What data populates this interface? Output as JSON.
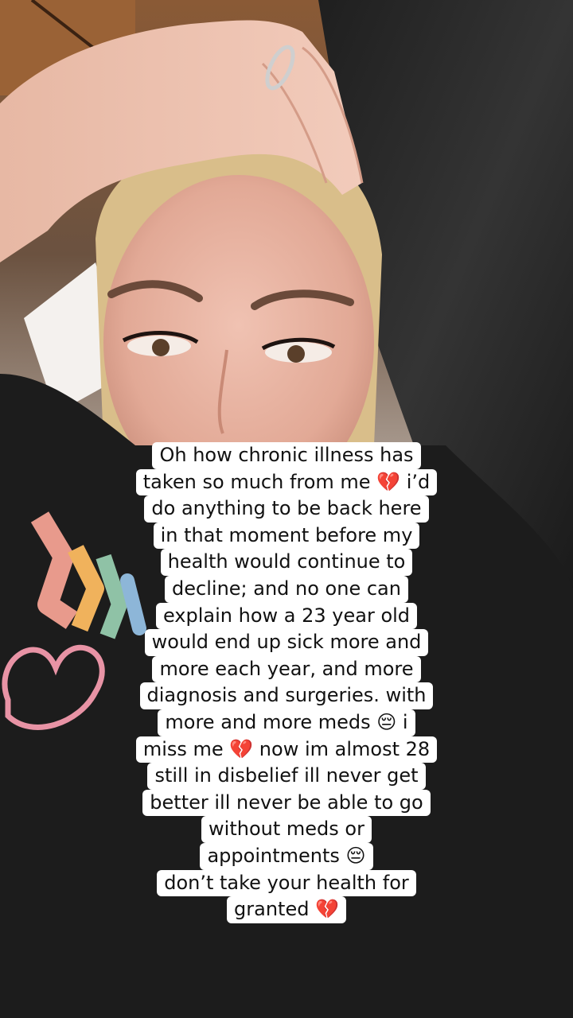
{
  "video": {
    "caption_lines": [
      "Oh how chronic illness has",
      "taken so much from me 💔 i’d",
      "do anything to be back here",
      "in that moment before my",
      "health would continue to",
      "decline; and no one can",
      "explain how a 23 year old",
      "would end up sick more and",
      "more each year, and more",
      "diagnosis and surgeries. with",
      "more and more meds 😔 i",
      "miss me 💔 now im almost 28",
      "still in disbelief ill never get",
      "better ill never be able to go",
      "without meds or",
      "appointments 😔",
      "don’t take your health for",
      "granted 💔"
    ]
  },
  "colors": {
    "caption_bg": "#ffffff",
    "caption_text": "#111111",
    "shirt": "#1c1c1c",
    "pillow": "#262626",
    "skin": "#e3ae9b",
    "hair": "#d9be8a"
  }
}
